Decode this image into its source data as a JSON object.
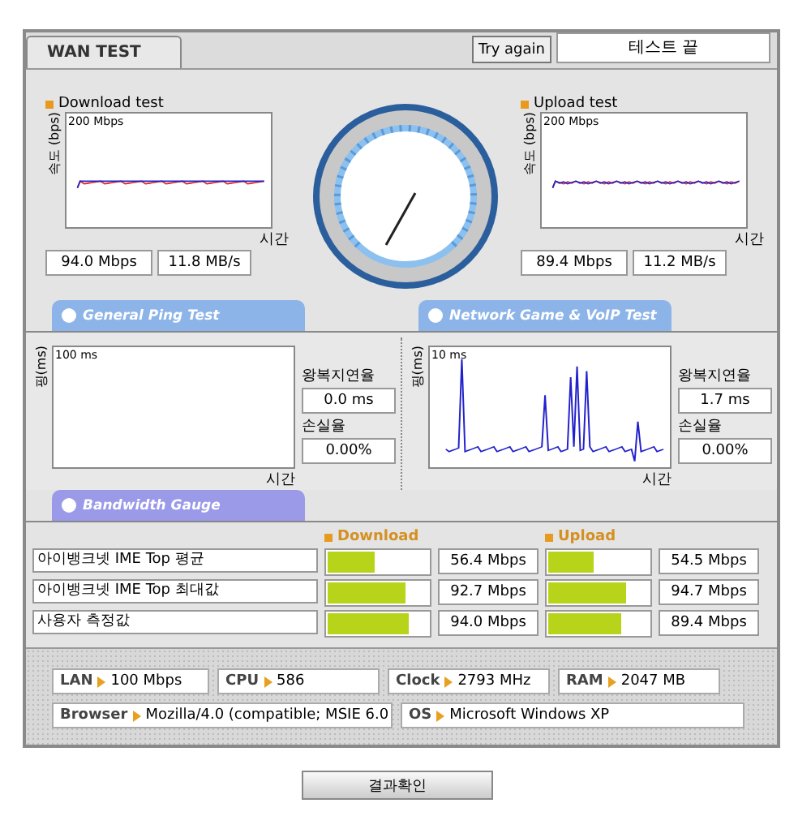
{
  "tab": {
    "label": "WAN TEST",
    "selected": true
  },
  "try_again": "Try again",
  "status": "테스트 끝",
  "tests": [
    {
      "title": "Download test",
      "axis": "속도 (bps)",
      "top": "200 Mbps",
      "x": "시간",
      "mbps": "94.0 Mbps",
      "mbs": "11.8 MB/s"
    },
    {
      "title": "Upload test",
      "axis": "속도 (bps)",
      "top": "200 Mbps",
      "x": "시간",
      "mbps": "89.4 Mbps",
      "mbs": "11.2 MB/s"
    }
  ],
  "section_tabs": [
    {
      "label": "General Ping Test",
      "color": "#8cb4e8"
    },
    {
      "label": "Network Game & VoIP Test",
      "color": "#8cb4e8"
    }
  ],
  "ping": [
    {
      "axis": "핑(ms)",
      "top": "100 ms",
      "x": "시간",
      "has_trace": false,
      "latency_label": "왕복지연율",
      "latency": "0.0 ms",
      "loss_label": "손실율",
      "loss": "0.00%"
    },
    {
      "axis": "핑(ms)",
      "top": "10 ms",
      "x": "시간",
      "has_trace": true,
      "latency_label": "왕복지연율",
      "latency": "1.7 ms",
      "loss_label": "손실율",
      "loss": "0.00%"
    }
  ],
  "bandwidth": {
    "tab": {
      "label": "Bandwidth Gauge",
      "color": "#9a9ae8"
    },
    "headers": [
      "Download",
      "Upload"
    ],
    "rows": [
      {
        "label": "아이뱅크넷 IME Top  평균",
        "download": {
          "level": 0.47,
          "reading": "56.4 Mbps"
        },
        "upload": {
          "level": 0.45,
          "reading": "54.5 Mbps"
        }
      },
      {
        "label": "아이뱅크넷 IME Top  최대값",
        "download": {
          "level": 0.78,
          "reading": "92.7 Mbps"
        },
        "upload": {
          "level": 0.78,
          "reading": "94.7 Mbps"
        }
      },
      {
        "label": "사용자 측정값",
        "download": {
          "level": 0.8,
          "reading": "94.0 Mbps"
        },
        "upload": {
          "level": 0.73,
          "reading": "89.4 Mbps"
        }
      }
    ]
  },
  "system": [
    [
      {
        "label": "LAN",
        "value": "100 Mbps"
      },
      {
        "label": "CPU",
        "value": "586"
      },
      {
        "label": "Clock",
        "value": "2793 MHz"
      },
      {
        "label": "RAM",
        "value": "2047 MB"
      }
    ],
    [
      {
        "label": "Browser",
        "value": "Mozilla/4.0 (compatible; MSIE 6.0"
      },
      {
        "label": "OS",
        "value": "Microsoft Windows XP"
      }
    ]
  ],
  "confirm": "결과확인"
}
